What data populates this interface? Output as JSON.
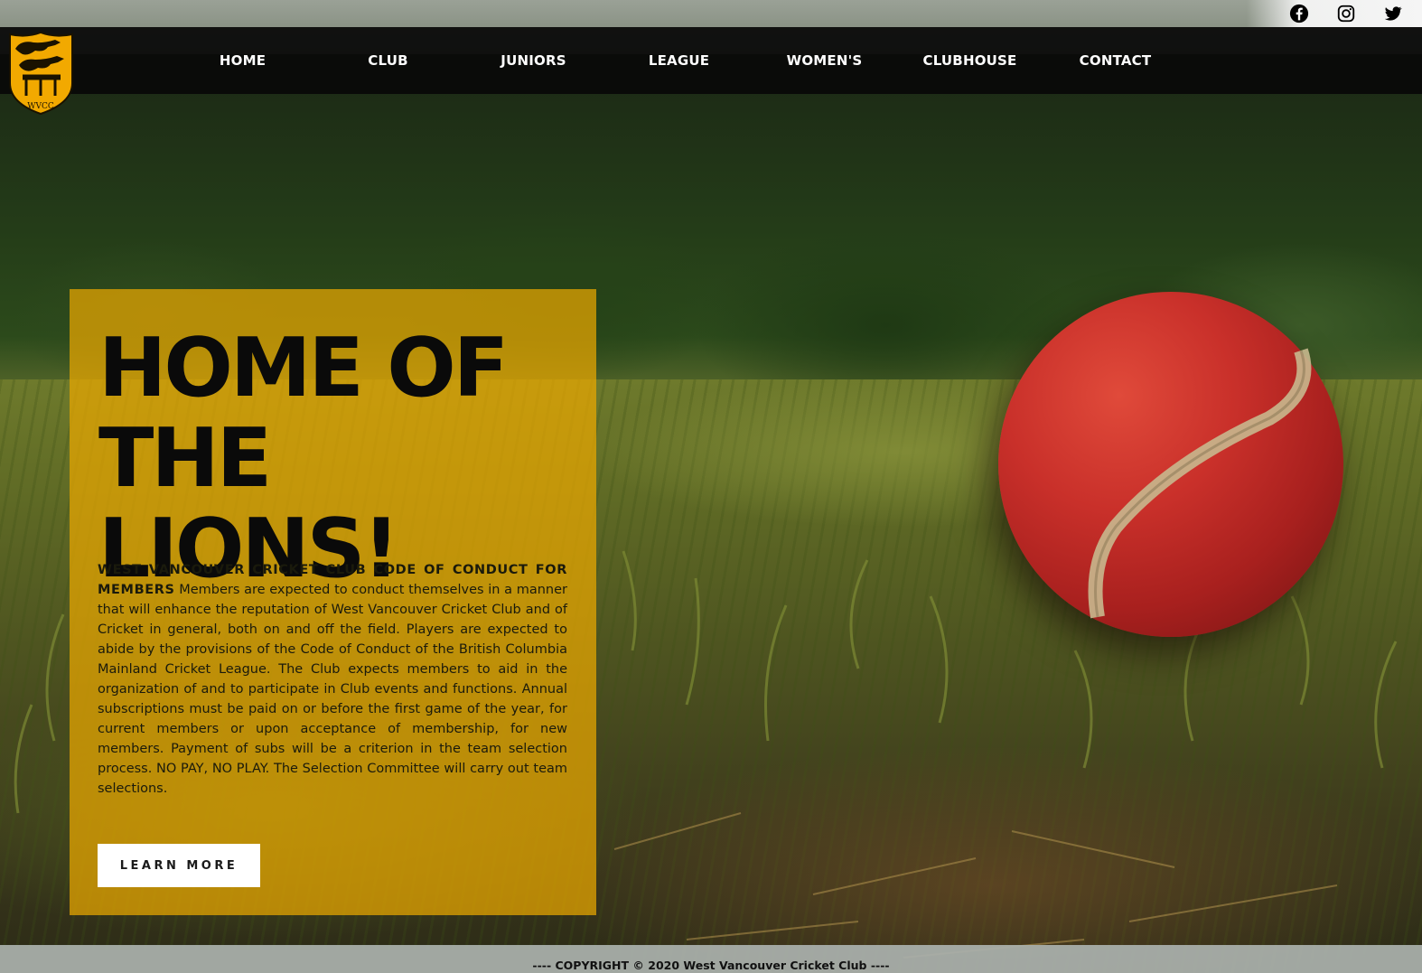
{
  "social": {
    "items": [
      {
        "name": "facebook"
      },
      {
        "name": "instagram"
      },
      {
        "name": "twitter"
      }
    ]
  },
  "logo": {
    "text": "WVCC"
  },
  "nav": {
    "items": [
      {
        "label": "HOME"
      },
      {
        "label": "CLUB"
      },
      {
        "label": "JUNIORS"
      },
      {
        "label": "LEAGUE"
      },
      {
        "label": "WOMEN'S"
      },
      {
        "label": "CLUBHOUSE"
      },
      {
        "label": "CONTACT"
      }
    ]
  },
  "hero": {
    "title_line1": "HOME OF",
    "title_line2": "THE LIONS!",
    "body_heading": "WEST VANCOUVER CRICKET CLUB CODE OF CONDUCT FOR MEMBERS",
    "body_text": " Members are expected to conduct themselves in a manner that will enhance the reputation of West Vancouver Cricket Club and of Cricket in general, both on and off the field. Players are expected to abide by the provisions of the Code of Conduct of the British Columbia Mainland Cricket League. The Club expects members to aid in the organization of and to participate in Club events and functions. Annual subscriptions must be paid on or before the first game of the year, for current members or upon acceptance of membership, for new members. Payment of subs will be a criterion in the team selection process. NO PAY, NO PLAY. The Selection Committee will carry out team selections.",
    "button_label": "LEARN MORE"
  },
  "footer": {
    "text": "---- COPYRIGHT © 2020 West Vancouver Cricket Club ----"
  },
  "colors": {
    "accent": "#EAA800",
    "nav_bg": "#080808",
    "ball_red": "#C9302A"
  }
}
